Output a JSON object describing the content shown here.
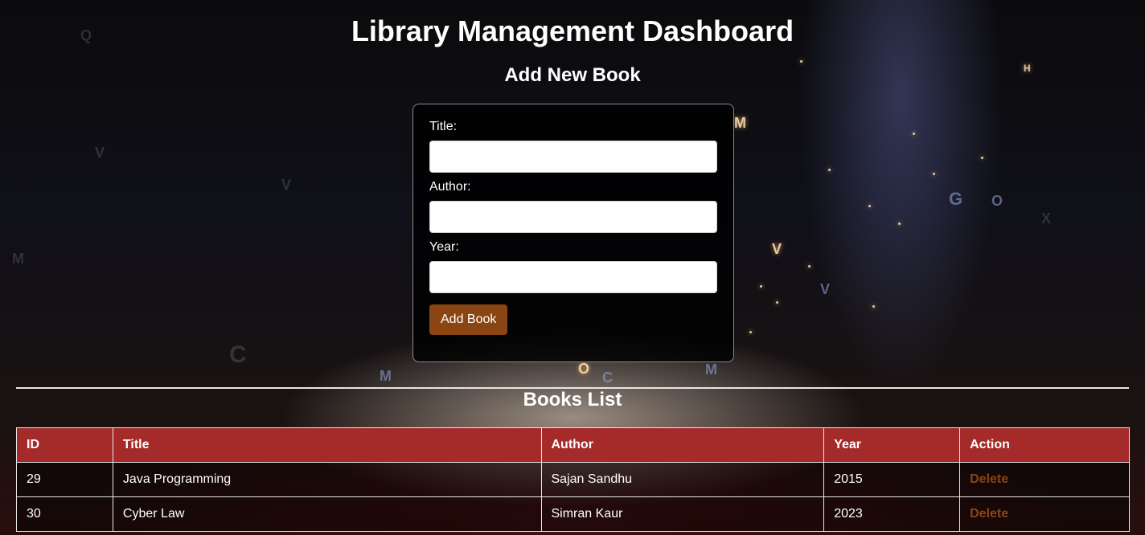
{
  "page": {
    "title": "Library Management Dashboard"
  },
  "form": {
    "heading": "Add New Book",
    "title_label": "Title:",
    "title_value": "",
    "author_label": "Author:",
    "author_value": "",
    "year_label": "Year:",
    "year_value": "",
    "submit_label": "Add Book"
  },
  "books": {
    "heading": "Books List",
    "columns": [
      "ID",
      "Title",
      "Author",
      "Year",
      "Action"
    ],
    "rows": [
      {
        "id": "29",
        "title": "Java Programming",
        "author": "Sajan Sandhu",
        "year": "2015",
        "action": "Delete"
      },
      {
        "id": "30",
        "title": "Cyber Law",
        "author": "Simran Kaur",
        "year": "2023",
        "action": "Delete"
      }
    ]
  },
  "colors": {
    "header_bg": "#a52a2a",
    "button_bg": "#8b4513",
    "delete_link": "#8b4513"
  }
}
